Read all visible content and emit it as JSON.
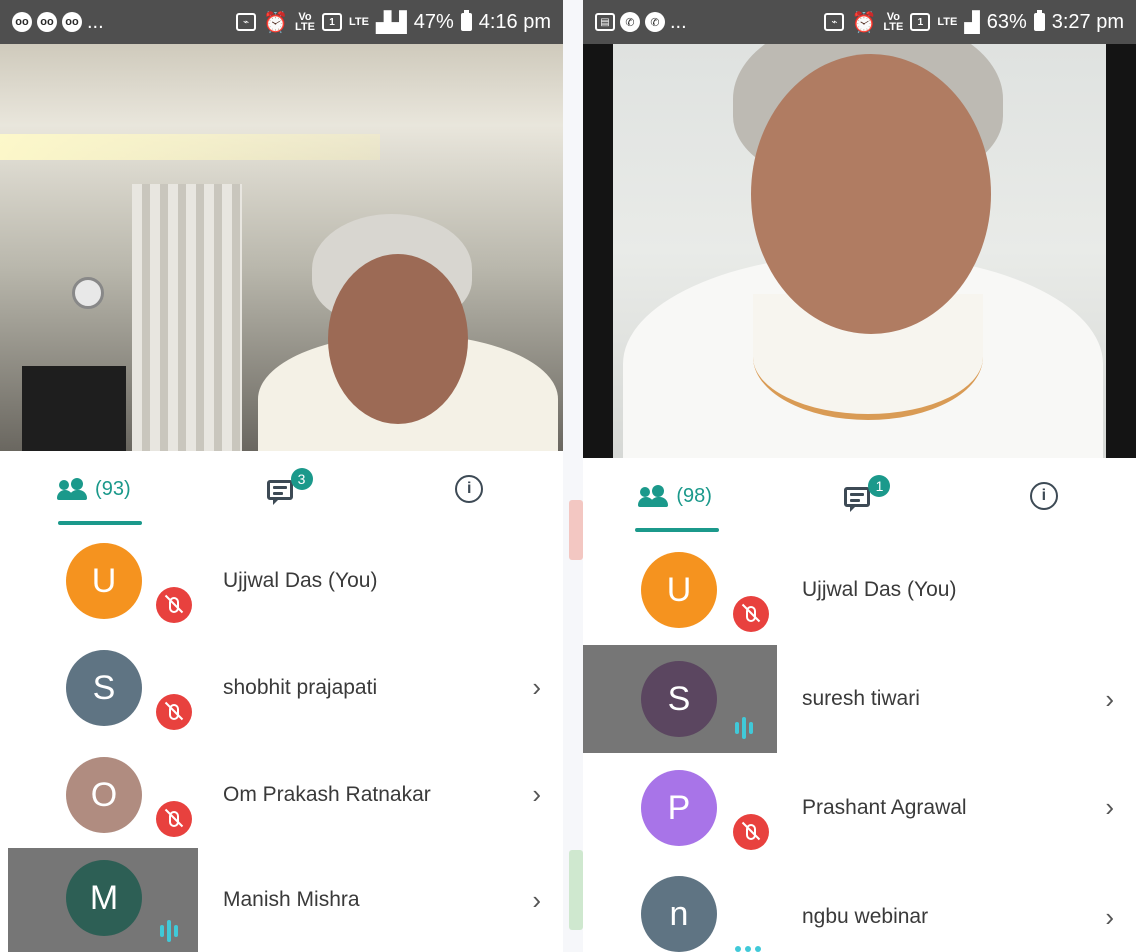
{
  "left": {
    "status": {
      "time": "4:16 pm",
      "battery": "47%",
      "notifications": [
        "oo",
        "oo",
        "oo"
      ],
      "more": "..."
    },
    "tabs": {
      "people_count": "(93)",
      "chat_badge": "3"
    },
    "participants": [
      {
        "initial": "U",
        "name": "Ujjwal Das (You)",
        "color": "#f5931f",
        "state": "muted",
        "chevron": ""
      },
      {
        "initial": "S",
        "name": "shobhit prajapati",
        "color": "#5f7483",
        "state": "muted",
        "chevron": "›"
      },
      {
        "initial": "O",
        "name": "Om Prakash Ratnakar",
        "color": "#b08c80",
        "state": "muted",
        "chevron": "›"
      },
      {
        "initial": "M",
        "name": "Manish Mishra",
        "color": "#2d5f55",
        "state": "speaking",
        "chevron": "›"
      }
    ]
  },
  "right": {
    "status": {
      "time": "3:27 pm",
      "battery": "63%",
      "more": "..."
    },
    "tabs": {
      "people_count": "(98)",
      "chat_badge": "1"
    },
    "participants": [
      {
        "initial": "U",
        "name": "Ujjwal Das (You)",
        "color": "#f5931f",
        "state": "muted",
        "chevron": ""
      },
      {
        "initial": "S",
        "name": "suresh tiwari",
        "color": "#5b4660",
        "state": "speaking",
        "chevron": "›"
      },
      {
        "initial": "P",
        "name": "Prashant Agrawal",
        "color": "#a874e8",
        "state": "muted",
        "chevron": "›"
      },
      {
        "initial": "n",
        "name": "ngbu webinar",
        "color": "#5f7483",
        "state": "typing",
        "chevron": "›"
      }
    ]
  },
  "colors": {
    "accent": "#1b998b",
    "muted": "#e8413e",
    "speaking": "#40c9d8",
    "active_row": "#767676"
  }
}
